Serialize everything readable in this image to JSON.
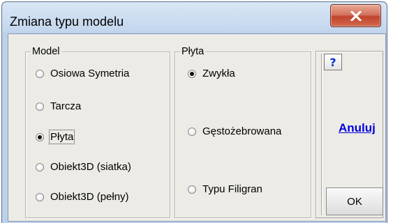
{
  "window": {
    "title": "Zmiana typu modelu",
    "close_label": "X"
  },
  "model_group": {
    "title": "Model",
    "options": [
      {
        "label": "Osiowa Symetria",
        "checked": false
      },
      {
        "label": "Tarcza",
        "checked": false
      },
      {
        "label": "Płyta",
        "checked": true
      },
      {
        "label": "Obiekt3D (siatka)",
        "checked": false
      },
      {
        "label": "Obiekt3D (pełny)",
        "checked": false
      }
    ]
  },
  "plate_group": {
    "title": "Płyta",
    "options": [
      {
        "label": "Zwykła",
        "checked": true
      },
      {
        "label": "Gęstożebrowana",
        "checked": false
      },
      {
        "label": "Typu Filigran",
        "checked": false
      }
    ]
  },
  "actions": {
    "help_label": "?",
    "cancel_label": "Anuluj",
    "ok_label": "OK"
  }
}
